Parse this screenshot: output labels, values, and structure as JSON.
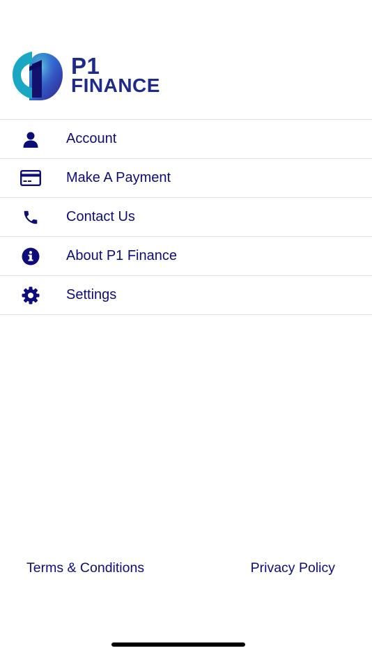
{
  "logo": {
    "line1": "P1",
    "line2": "FINANCE"
  },
  "menu": {
    "items": [
      {
        "label": "Account",
        "icon": "user-icon"
      },
      {
        "label": "Make A Payment",
        "icon": "credit-card-icon"
      },
      {
        "label": "Contact Us",
        "icon": "phone-icon"
      },
      {
        "label": "About P1 Finance",
        "icon": "info-icon"
      },
      {
        "label": "Settings",
        "icon": "gear-icon"
      }
    ]
  },
  "footer": {
    "terms": "Terms & Conditions",
    "privacy": "Privacy Policy"
  },
  "colors": {
    "primary": "#0d0d7a",
    "divider": "#e0e0e0"
  }
}
